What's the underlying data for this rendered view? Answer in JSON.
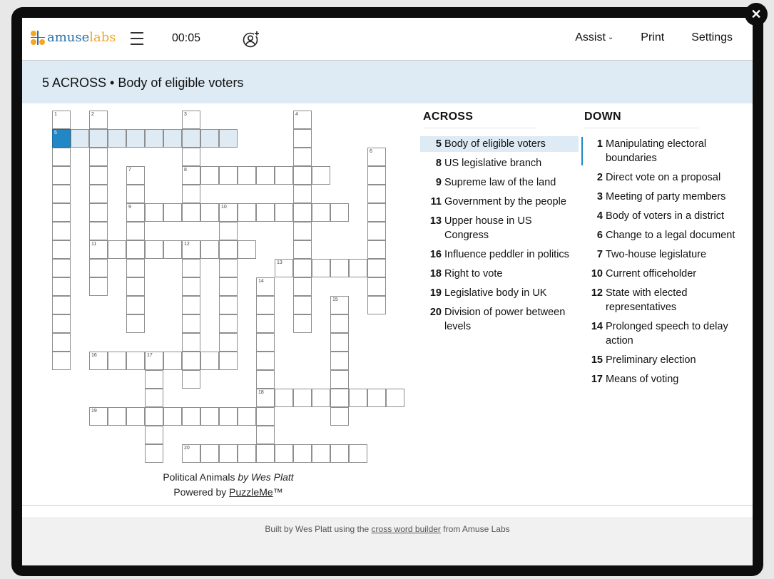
{
  "app": {
    "logo": {
      "part1": "amuse",
      "part2": "labs"
    },
    "timer": "00:05",
    "nav": {
      "assist": "Assist",
      "print": "Print",
      "settings": "Settings"
    },
    "close_symbol": "✕"
  },
  "active_clue_bar": "5 ACROSS • Body of eligible voters",
  "colors": {
    "selected_cell": "#2288c5",
    "highlight": "#deebf4",
    "logo_blue": "#2a6fa8",
    "logo_orange": "#f5a623"
  },
  "grid": {
    "rows": 19,
    "cols": 19,
    "cells": [
      [
        0,
        0
      ],
      [
        0,
        2
      ],
      [
        0,
        7
      ],
      [
        0,
        13
      ],
      [
        1,
        0
      ],
      [
        1,
        1
      ],
      [
        1,
        2
      ],
      [
        1,
        3
      ],
      [
        1,
        4
      ],
      [
        1,
        5
      ],
      [
        1,
        6
      ],
      [
        1,
        7
      ],
      [
        1,
        8
      ],
      [
        1,
        9
      ],
      [
        1,
        13
      ],
      [
        2,
        0
      ],
      [
        2,
        2
      ],
      [
        2,
        7
      ],
      [
        2,
        13
      ],
      [
        2,
        17
      ],
      [
        3,
        0
      ],
      [
        3,
        2
      ],
      [
        3,
        4
      ],
      [
        3,
        7
      ],
      [
        3,
        8
      ],
      [
        3,
        9
      ],
      [
        3,
        10
      ],
      [
        3,
        11
      ],
      [
        3,
        12
      ],
      [
        3,
        13
      ],
      [
        3,
        14
      ],
      [
        3,
        17
      ],
      [
        4,
        0
      ],
      [
        4,
        2
      ],
      [
        4,
        4
      ],
      [
        4,
        7
      ],
      [
        4,
        13
      ],
      [
        4,
        17
      ],
      [
        5,
        0
      ],
      [
        5,
        2
      ],
      [
        5,
        4
      ],
      [
        5,
        5
      ],
      [
        5,
        6
      ],
      [
        5,
        7
      ],
      [
        5,
        8
      ],
      [
        5,
        9
      ],
      [
        5,
        10
      ],
      [
        5,
        11
      ],
      [
        5,
        12
      ],
      [
        5,
        13
      ],
      [
        5,
        14
      ],
      [
        5,
        15
      ],
      [
        5,
        17
      ],
      [
        6,
        0
      ],
      [
        6,
        2
      ],
      [
        6,
        4
      ],
      [
        6,
        9
      ],
      [
        6,
        13
      ],
      [
        6,
        17
      ],
      [
        7,
        0
      ],
      [
        7,
        2
      ],
      [
        7,
        3
      ],
      [
        7,
        4
      ],
      [
        7,
        5
      ],
      [
        7,
        6
      ],
      [
        7,
        7
      ],
      [
        7,
        8
      ],
      [
        7,
        9
      ],
      [
        7,
        10
      ],
      [
        7,
        13
      ],
      [
        7,
        17
      ],
      [
        8,
        0
      ],
      [
        8,
        2
      ],
      [
        8,
        4
      ],
      [
        8,
        7
      ],
      [
        8,
        9
      ],
      [
        8,
        12
      ],
      [
        8,
        13
      ],
      [
        8,
        14
      ],
      [
        8,
        15
      ],
      [
        8,
        16
      ],
      [
        8,
        17
      ],
      [
        9,
        0
      ],
      [
        9,
        2
      ],
      [
        9,
        4
      ],
      [
        9,
        7
      ],
      [
        9,
        9
      ],
      [
        9,
        11
      ],
      [
        9,
        13
      ],
      [
        9,
        17
      ],
      [
        10,
        0
      ],
      [
        10,
        4
      ],
      [
        10,
        7
      ],
      [
        10,
        9
      ],
      [
        10,
        11
      ],
      [
        10,
        13
      ],
      [
        10,
        15
      ],
      [
        10,
        17
      ],
      [
        11,
        0
      ],
      [
        11,
        4
      ],
      [
        11,
        7
      ],
      [
        11,
        9
      ],
      [
        11,
        11
      ],
      [
        11,
        13
      ],
      [
        11,
        15
      ],
      [
        12,
        0
      ],
      [
        12,
        7
      ],
      [
        12,
        9
      ],
      [
        12,
        11
      ],
      [
        12,
        15
      ],
      [
        13,
        0
      ],
      [
        13,
        2
      ],
      [
        13,
        3
      ],
      [
        13,
        4
      ],
      [
        13,
        5
      ],
      [
        13,
        6
      ],
      [
        13,
        7
      ],
      [
        13,
        8
      ],
      [
        13,
        9
      ],
      [
        13,
        11
      ],
      [
        13,
        15
      ],
      [
        14,
        5
      ],
      [
        14,
        7
      ],
      [
        14,
        11
      ],
      [
        14,
        15
      ],
      [
        15,
        5
      ],
      [
        15,
        11
      ],
      [
        15,
        12
      ],
      [
        15,
        13
      ],
      [
        15,
        14
      ],
      [
        15,
        15
      ],
      [
        15,
        16
      ],
      [
        15,
        17
      ],
      [
        15,
        18
      ],
      [
        16,
        2
      ],
      [
        16,
        3
      ],
      [
        16,
        4
      ],
      [
        16,
        5
      ],
      [
        16,
        6
      ],
      [
        16,
        7
      ],
      [
        16,
        8
      ],
      [
        16,
        9
      ],
      [
        16,
        10
      ],
      [
        16,
        11
      ],
      [
        16,
        15
      ],
      [
        17,
        5
      ],
      [
        17,
        11
      ],
      [
        18,
        5
      ],
      [
        18,
        7
      ],
      [
        18,
        8
      ],
      [
        18,
        9
      ],
      [
        18,
        10
      ],
      [
        18,
        11
      ],
      [
        18,
        12
      ],
      [
        18,
        13
      ],
      [
        18,
        14
      ],
      [
        18,
        15
      ],
      [
        18,
        16
      ]
    ],
    "numbers": [
      {
        "n": "1",
        "r": 0,
        "c": 0
      },
      {
        "n": "2",
        "r": 0,
        "c": 2
      },
      {
        "n": "3",
        "r": 0,
        "c": 7
      },
      {
        "n": "4",
        "r": 0,
        "c": 13
      },
      {
        "n": "5",
        "r": 1,
        "c": 0
      },
      {
        "n": "6",
        "r": 2,
        "c": 17
      },
      {
        "n": "7",
        "r": 3,
        "c": 4
      },
      {
        "n": "8",
        "r": 3,
        "c": 7
      },
      {
        "n": "9",
        "r": 5,
        "c": 4
      },
      {
        "n": "10",
        "r": 5,
        "c": 9
      },
      {
        "n": "11",
        "r": 7,
        "c": 2
      },
      {
        "n": "12",
        "r": 7,
        "c": 7
      },
      {
        "n": "13",
        "r": 8,
        "c": 12
      },
      {
        "n": "14",
        "r": 9,
        "c": 11
      },
      {
        "n": "15",
        "r": 10,
        "c": 15
      },
      {
        "n": "16",
        "r": 13,
        "c": 2
      },
      {
        "n": "17",
        "r": 13,
        "c": 5
      },
      {
        "n": "18",
        "r": 15,
        "c": 11
      },
      {
        "n": "19",
        "r": 16,
        "c": 2
      },
      {
        "n": "20",
        "r": 18,
        "c": 7
      }
    ],
    "selected": [
      1,
      0
    ],
    "highlighted_word": {
      "row": 1,
      "from_col": 0,
      "to_col": 9
    }
  },
  "credits": {
    "title": "Political Animals",
    "by": "by Wes Platt",
    "powered_prefix": "Powered by ",
    "powered_link": "PuzzleMe",
    "tm": "™"
  },
  "across": {
    "heading": "ACROSS",
    "clues": [
      {
        "n": "5",
        "text": "Body of eligible voters"
      },
      {
        "n": "8",
        "text": "US legislative branch"
      },
      {
        "n": "9",
        "text": "Supreme law of the land"
      },
      {
        "n": "11",
        "text": "Government by the people"
      },
      {
        "n": "13",
        "text": "Upper house in US Congress"
      },
      {
        "n": "16",
        "text": "Influence peddler in politics"
      },
      {
        "n": "18",
        "text": "Right to vote"
      },
      {
        "n": "19",
        "text": "Legislative body in UK"
      },
      {
        "n": "20",
        "text": "Division of power between levels"
      }
    ]
  },
  "down": {
    "heading": "DOWN",
    "clues": [
      {
        "n": "1",
        "text": "Manipulating electoral boundaries"
      },
      {
        "n": "2",
        "text": "Direct vote on a proposal"
      },
      {
        "n": "3",
        "text": "Meeting of party members"
      },
      {
        "n": "4",
        "text": "Body of voters in a district"
      },
      {
        "n": "6",
        "text": "Change to a legal document"
      },
      {
        "n": "7",
        "text": "Two-house legislature"
      },
      {
        "n": "10",
        "text": "Current officeholder"
      },
      {
        "n": "12",
        "text": "State with elected representatives"
      },
      {
        "n": "14",
        "text": "Prolonged speech to delay action"
      },
      {
        "n": "15",
        "text": "Preliminary election"
      },
      {
        "n": "17",
        "text": "Means of voting"
      }
    ]
  },
  "footer": {
    "prefix": "Built by Wes Platt using the ",
    "link": "cross word builder",
    "suffix": " from Amuse Labs"
  }
}
